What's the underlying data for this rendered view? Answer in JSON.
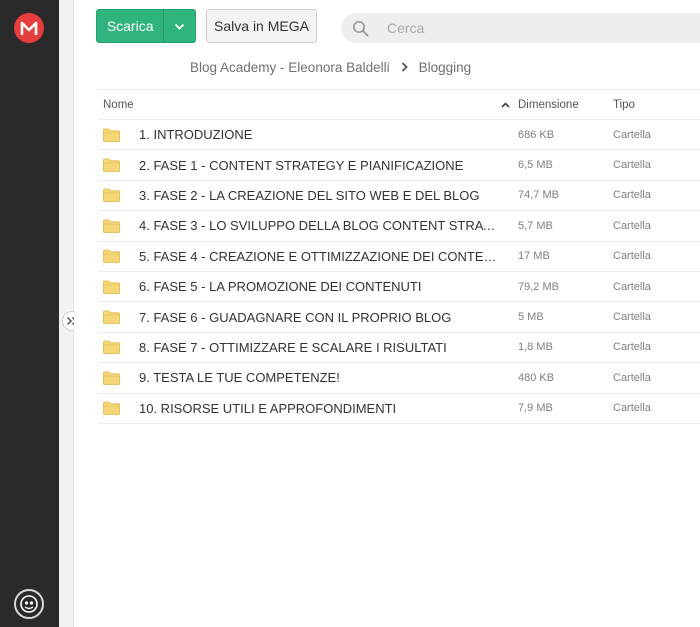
{
  "toolbar": {
    "download_label": "Scarica",
    "save_label": "Salva in MEGA"
  },
  "search": {
    "placeholder": "Cerca"
  },
  "breadcrumb": {
    "parent": "Blog Academy - Eleonora Baldelli",
    "current": "Blogging"
  },
  "table": {
    "headers": {
      "name": "Nome",
      "size": "Dimensione",
      "type": "Tipo"
    },
    "rows": [
      {
        "name": "1. INTRODUZIONE",
        "size": "686 KB",
        "type": "Cartella"
      },
      {
        "name": "2. FASE 1 - CONTENT STRATEGY E PIANIFICAZIONE",
        "size": "6,5 MB",
        "type": "Cartella"
      },
      {
        "name": "3. FASE 2 - LA CREAZIONE DEL SITO WEB E DEL BLOG",
        "size": "74,7 MB",
        "type": "Cartella"
      },
      {
        "name": "4. FASE 3 - LO SVILUPPO DELLA BLOG CONTENT STRATE...",
        "size": "5,7 MB",
        "type": "Cartella"
      },
      {
        "name": "5. FASE 4 - CREAZIONE E OTTIMIZZAZIONE DEI CONTEN...",
        "size": "17 MB",
        "type": "Cartella"
      },
      {
        "name": "6. FASE 5 - LA PROMOZIONE DEI CONTENUTI",
        "size": "79,2 MB",
        "type": "Cartella"
      },
      {
        "name": "7. FASE 6 - GUADAGNARE CON IL PROPRIO BLOG",
        "size": "5 MB",
        "type": "Cartella"
      },
      {
        "name": "8. FASE 7 - OTTIMIZZARE E SCALARE I RISULTATI",
        "size": "1,8 MB",
        "type": "Cartella"
      },
      {
        "name": "9. TESTA LE TUE COMPETENZE!",
        "size": "480 KB",
        "type": "Cartella"
      },
      {
        "name": "10. RISORSE UTILI E APPROFONDIMENTI",
        "size": "7,9 MB",
        "type": "Cartella"
      }
    ]
  },
  "icons": {
    "logo": "mega-logo-icon",
    "folder": "folder-icon",
    "search": "search-icon",
    "sort": "chevron-up-icon",
    "dropdown": "chevron-down-icon",
    "expand": "double-chevron-right-icon",
    "account": "account-icon"
  },
  "colors": {
    "accent_green": "#2fb47e",
    "brand_red": "#e63d3d",
    "folder_yellow": "#f5d77a",
    "rail": "#2a2a2a"
  }
}
